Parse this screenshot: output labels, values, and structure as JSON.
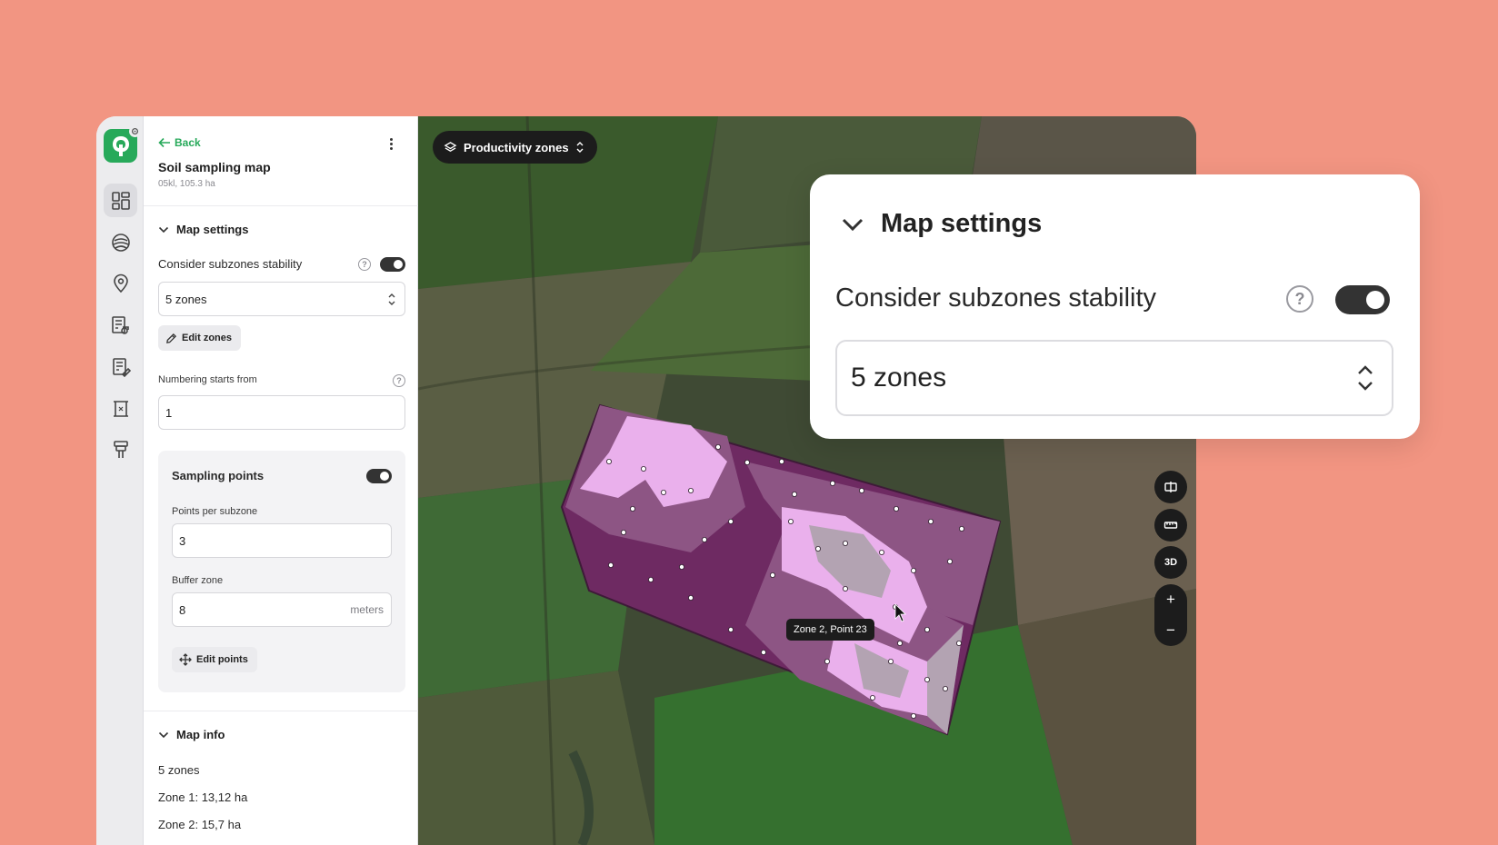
{
  "rail": {
    "items": [
      {
        "icon": "dashboard-icon",
        "active": true
      },
      {
        "icon": "field-icon",
        "active": false
      },
      {
        "icon": "location-pin-icon",
        "active": false
      },
      {
        "icon": "machinery-report-icon",
        "active": false
      },
      {
        "icon": "document-edit-icon",
        "active": false
      },
      {
        "icon": "crop-icon",
        "active": false
      },
      {
        "icon": "weather-station-icon",
        "active": false
      }
    ]
  },
  "panel": {
    "back_label": "Back",
    "title": "Soil sampling map",
    "subtitle": "05kl, 105.3 ha",
    "map_settings": {
      "heading": "Map settings",
      "subzones_label": "Consider subzones stability",
      "zones_value": "5 zones",
      "edit_zones_label": "Edit zones",
      "numbering_label": "Numbering starts from",
      "numbering_value": "1"
    },
    "sampling": {
      "heading": "Sampling points",
      "points_label": "Points per subzone",
      "points_value": "3",
      "buffer_label": "Buffer zone",
      "buffer_value": "8",
      "buffer_unit": "meters",
      "edit_points_label": "Edit points"
    },
    "map_info": {
      "heading": "Map info",
      "lines": [
        "5 zones",
        "Zone 1: 13,12 ha",
        "Zone 2: 15,7 ha"
      ]
    }
  },
  "map": {
    "layer_label": "Productivity zones",
    "controls": {
      "three_d": "3D",
      "zoom_in": "+",
      "zoom_out": "−"
    },
    "tooltip": "Zone 2, Point 23"
  },
  "callout": {
    "heading": "Map settings",
    "subzones_label": "Consider subzones stability",
    "zones_value": "5 zones"
  },
  "colors": {
    "background": "#f29582",
    "brand_green": "#27a95a",
    "zone_dark": "#6e2a62",
    "zone_mid": "#8d5584",
    "zone_light": "#eab0ec",
    "zone_grey": "#b3a3b2"
  }
}
